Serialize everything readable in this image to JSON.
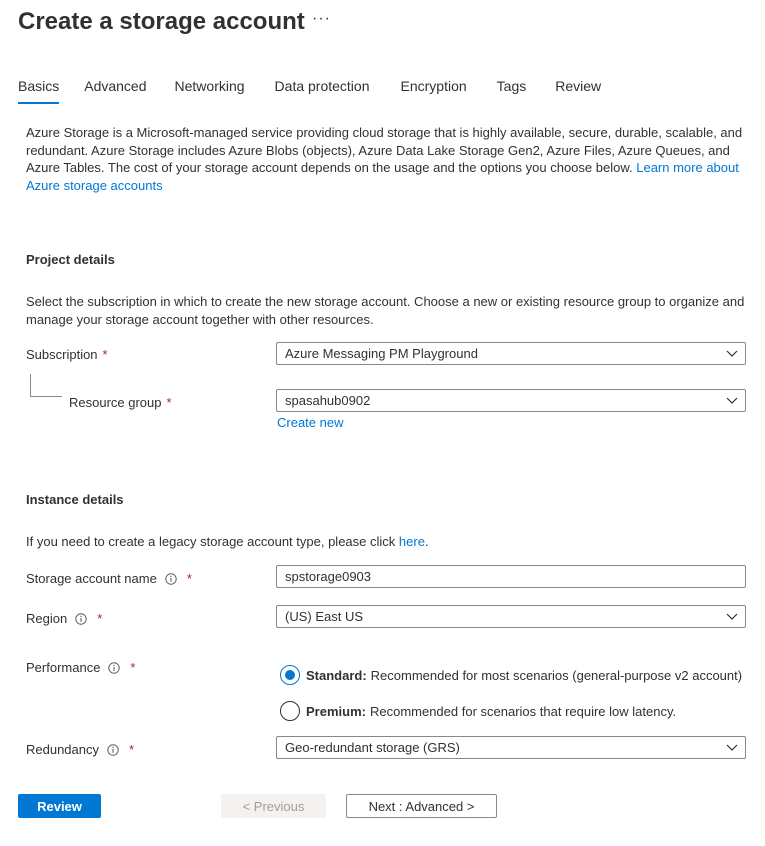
{
  "page": {
    "title": "Create a storage account",
    "more_label": "···"
  },
  "tabs": [
    {
      "label": "Basics",
      "active": true
    },
    {
      "label": "Advanced",
      "active": false
    },
    {
      "label": "Networking",
      "active": false
    },
    {
      "label": "Data protection",
      "active": false
    },
    {
      "label": "Encryption",
      "active": false
    },
    {
      "label": "Tags",
      "active": false
    },
    {
      "label": "Review",
      "active": false
    }
  ],
  "intro": {
    "text": "Azure Storage is a Microsoft-managed service providing cloud storage that is highly available, secure, durable, scalable, and redundant. Azure Storage includes Azure Blobs (objects), Azure Data Lake Storage Gen2, Azure Files, Azure Queues, and Azure Tables. The cost of your storage account depends on the usage and the options you choose below.",
    "link": "Learn more about Azure storage accounts"
  },
  "project": {
    "title": "Project details",
    "description": "Select the subscription in which to create the new storage account. Choose a new or existing resource group to organize and manage your storage account together with other resources.",
    "subscription_label": "Subscription",
    "subscription_value": "Azure Messaging PM Playground",
    "resource_group_label": "Resource group",
    "resource_group_value": "spasahub0902",
    "create_new": "Create new"
  },
  "instance": {
    "title": "Instance details",
    "legacy_text": "If you need to create a legacy storage account type, please click",
    "legacy_link": "here",
    "legacy_period": ".",
    "name_label": "Storage account name",
    "name_value": "spstorage0903",
    "region_label": "Region",
    "region_value": "(US) East US",
    "performance_label": "Performance",
    "standard_bold": "Standard:",
    "standard_text": "Recommended for most scenarios (general-purpose v2 account)",
    "standard_checked": true,
    "premium_bold": "Premium:",
    "premium_text": "Recommended for scenarios that require low latency.",
    "premium_checked": false,
    "redundancy_label": "Redundancy",
    "redundancy_value": "Geo-redundant storage (GRS)"
  },
  "required_marker": "*",
  "footer": {
    "review": "Review",
    "previous": "< Previous",
    "next": "Next : Advanced >"
  },
  "colors": {
    "accent": "#0078d4",
    "required": "#a4262c",
    "text": "#323130",
    "border": "#8a8886"
  },
  "icons": {
    "info": "info-icon",
    "chevron": "chevron-down-icon",
    "more": "more-icon"
  }
}
